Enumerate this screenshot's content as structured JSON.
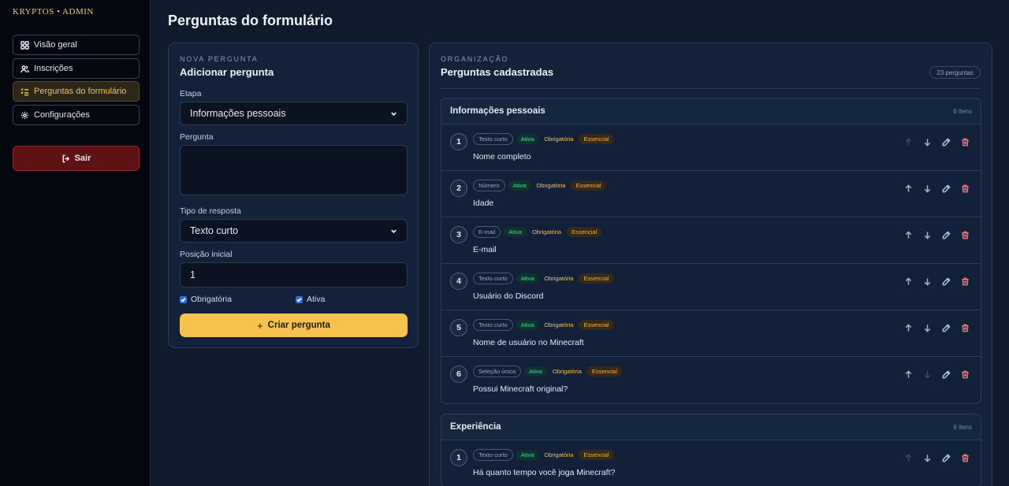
{
  "brand": "KRYPTOS • ADMIN",
  "sidebar": {
    "items": [
      {
        "label": "Visão geral",
        "icon": "grid-icon"
      },
      {
        "label": "Inscrições",
        "icon": "users-icon"
      },
      {
        "label": "Perguntas do formulário",
        "icon": "list-check-icon"
      },
      {
        "label": "Configurações",
        "icon": "gear-icon"
      }
    ],
    "active_index": 2,
    "logout_label": "Sair"
  },
  "page_title": "Perguntas do formulário",
  "new_question": {
    "eyebrow": "NOVA PERGUNTA",
    "title": "Adicionar pergunta",
    "stage_label": "Etapa",
    "stage_value": "Informações pessoais",
    "question_label": "Pergunta",
    "question_value": "",
    "type_label": "Tipo de resposta",
    "type_value": "Texto curto",
    "position_label": "Posição inicial",
    "position_value": "1",
    "required_label": "Obrigatória",
    "required_checked": true,
    "active_label": "Ativa",
    "active_checked": true,
    "submit_label": "Criar pergunta"
  },
  "registered": {
    "eyebrow": "ORGANIZAÇÃO",
    "title": "Perguntas cadastradas",
    "count_label": "23 perguntas",
    "groups": [
      {
        "name": "Informações pessoais",
        "count": "6 itens",
        "questions": [
          {
            "n": "1",
            "type": "Texto curto",
            "status": "Ativa",
            "required": "Obrigatória",
            "essential": "Essencial",
            "text": "Nome completo"
          },
          {
            "n": "2",
            "type": "Número",
            "status": "Ativa",
            "required": "Obrigatória",
            "essential": "Essencial",
            "text": "Idade"
          },
          {
            "n": "3",
            "type": "E-mail",
            "status": "Ativa",
            "required": "Obrigatória",
            "essential": "Essencial",
            "text": "E-mail"
          },
          {
            "n": "4",
            "type": "Texto curto",
            "status": "Ativa",
            "required": "Obrigatória",
            "essential": "Essencial",
            "text": "Usuário do Discord"
          },
          {
            "n": "5",
            "type": "Texto curto",
            "status": "Ativa",
            "required": "Obrigatória",
            "essential": "Essencial",
            "text": "Nome de usuário no Minecraft"
          },
          {
            "n": "6",
            "type": "Seleção única",
            "status": "Ativa",
            "required": "Obrigatória",
            "essential": "Essencial",
            "text": "Possui Minecraft original?"
          }
        ]
      },
      {
        "name": "Experiência",
        "count": "6 itens",
        "questions": [
          {
            "n": "1",
            "type": "Texto curto",
            "status": "Ativa",
            "required": "Obrigatória",
            "essential": "Essencial",
            "text": "Há quanto tempo você joga Minecraft?"
          }
        ]
      }
    ]
  },
  "colors": {
    "accent": "#f7c24e",
    "active_tag": "#3ed8a6",
    "danger": "#f07474",
    "background": "#0f1a2c"
  }
}
